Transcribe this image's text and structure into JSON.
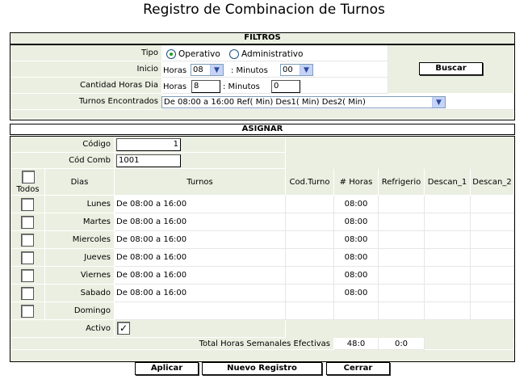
{
  "page": {
    "title": "Registro de Combinacion de Turnos"
  },
  "filtros": {
    "header": "FILTROS",
    "tipo_label": "Tipo",
    "tipo_options": [
      "Operativo",
      "Administrativo"
    ],
    "tipo_selected": "Operativo",
    "inicio_label": "Inicio",
    "horas_label": "Horas",
    "horas_value": "08",
    "minutos_label": ": Minutos",
    "minutos_value": "00",
    "cantidad_label": "Cantidad Horas Dia",
    "cantidad_horas_label": "Horas",
    "cantidad_horas_value": "8",
    "cantidad_minutos_label": ": Minutos",
    "cantidad_minutos_value": "0",
    "turnos_label": "Turnos Encontrados",
    "turnos_value": "De 08:00 a 16:00 Ref( Min) Des1( Min) Des2( Min)",
    "buscar_label": "Buscar"
  },
  "asignar": {
    "header": "ASIGNAR",
    "codigo_label": "Código",
    "codigo_value": "1",
    "codcomb_label": "Cód Comb",
    "codcomb_value": "1001",
    "columns": {
      "todos": "Todos",
      "dias": "Dias",
      "turnos": "Turnos",
      "cod_turno": "Cod.Turno",
      "horas": "# Horas",
      "refrigerio": "Refrigerio",
      "descan1": "Descan_1",
      "descan2": "Descan_2"
    },
    "rows": [
      {
        "dia": "Lunes",
        "turno": "De 08:00 a 16:00",
        "horas": "08:00"
      },
      {
        "dia": "Martes",
        "turno": "De 08:00 a 16:00",
        "horas": "08:00"
      },
      {
        "dia": "Miercoles",
        "turno": "De 08:00 a 16:00",
        "horas": "08:00"
      },
      {
        "dia": "Jueves",
        "turno": "De 08:00 a 16:00",
        "horas": "08:00"
      },
      {
        "dia": "Viernes",
        "turno": "De 08:00 a 16:00",
        "horas": "08:00"
      },
      {
        "dia": "Sabado",
        "turno": "De 08:00 a 16:00",
        "horas": "08:00"
      },
      {
        "dia": "Domingo",
        "turno": "",
        "horas": ""
      }
    ],
    "activo_label": "Activo",
    "activo_checked": true,
    "total_label": "Total Horas Semanales Efectivas",
    "total_horas": "48:0",
    "total_otro": "0:0"
  },
  "buttons": {
    "aplicar": "Aplicar",
    "nuevo": "Nuevo Registro",
    "cerrar": "Cerrar"
  }
}
